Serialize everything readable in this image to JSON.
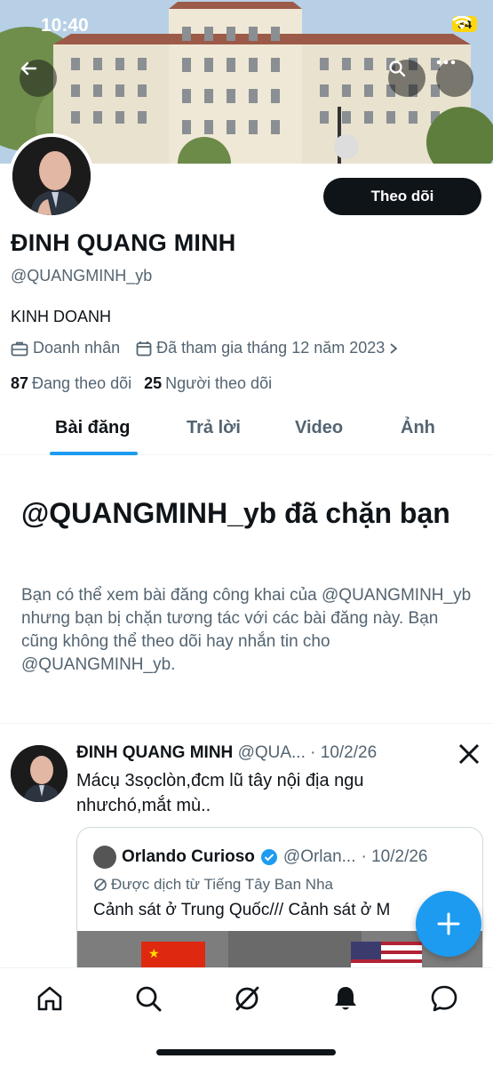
{
  "status_bar": {
    "time": "10:40",
    "battery": "34"
  },
  "profile": {
    "follow_label": "Theo dõi",
    "name": "ĐINH QUANG MINH",
    "handle": "@QUANGMINH_yb",
    "bio": "KINH DOANH",
    "profession": "Doanh nhân",
    "joined": "Đã tham gia tháng 12 năm 2023",
    "following_count": "87",
    "following_label": "Đang theo dõi",
    "followers_count": "25",
    "followers_label": "Người theo dõi"
  },
  "tabs": [
    "Bài đăng",
    "Trả lời",
    "Video",
    "Ảnh"
  ],
  "blocked": {
    "title": "@QUANGMINH_yb đã chặn bạn",
    "text": "Bạn có thể xem bài đăng công khai của @QUANGMINH_yb nhưng bạn bị chặn tương tác với các bài đăng này. Bạn cũng không thể theo dõi hay nhắn tin cho @QUANGMINH_yb."
  },
  "post": {
    "name": "ĐINH QUANG MINH",
    "handle": "@QUA...",
    "date": "· 10/2/26",
    "text": "Mácụ 3sọclòn,đcm lũ tây nội địa ngu nhưchó,mắt mù..",
    "quote": {
      "name": "Orlando Curioso",
      "handle": "@Orlan...",
      "date": "· 10/2/26",
      "translated": "Được dịch từ Tiếng Tây Ban Nha",
      "text": "Cảnh sát ở Trung Quốc/// Cảnh sát ở M"
    }
  },
  "colors": {
    "accent": "#1d9bf0",
    "text": "#0f1419",
    "muted": "#536471",
    "battery": "#ffd60a"
  },
  "icons": [
    "back-arrow-icon",
    "search-icon",
    "more-icon",
    "briefcase-icon",
    "calendar-icon",
    "chevron-right-icon",
    "verified-icon",
    "translate-icon",
    "plus-icon",
    "home-icon",
    "explore-icon",
    "grok-icon",
    "notifications-icon",
    "messages-icon"
  ]
}
